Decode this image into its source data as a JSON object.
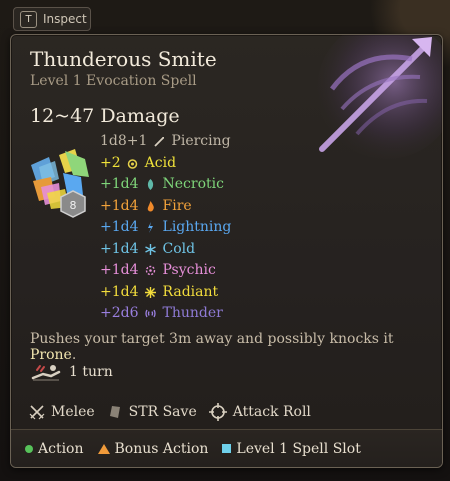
{
  "inspect": {
    "key": "T",
    "label": "Inspect"
  },
  "spell": {
    "title": "Thunderous Smite",
    "subtitle": "Level 1 Evocation Spell",
    "damage_total": "12~47 Damage",
    "dice_level": "8"
  },
  "damage": [
    {
      "amount": "1d8+1",
      "icon": "sword-icon",
      "type": "Piercing"
    },
    {
      "amount": "+2",
      "icon": "acid-icon",
      "type": "Acid"
    },
    {
      "amount": "+1d4",
      "icon": "necrotic-icon",
      "type": "Necrotic"
    },
    {
      "amount": "+1d4",
      "icon": "fire-icon",
      "type": "Fire"
    },
    {
      "amount": "+1d4",
      "icon": "lightning-icon",
      "type": "Lightning"
    },
    {
      "amount": "+1d4",
      "icon": "cold-icon",
      "type": "Cold"
    },
    {
      "amount": "+1d4",
      "icon": "psychic-icon",
      "type": "Psychic"
    },
    {
      "amount": "+1d4",
      "icon": "radiant-icon",
      "type": "Radiant"
    },
    {
      "amount": "+2d6",
      "icon": "thunder-icon",
      "type": "Thunder"
    }
  ],
  "description": {
    "text": "Pushes your target 3m away and possibly knocks it ",
    "keyword": "Prone",
    "end": "."
  },
  "duration": {
    "icon": "prone-icon",
    "label": "1 turn"
  },
  "properties": [
    {
      "icon": "melee-icon",
      "label": "Melee"
    },
    {
      "icon": "save-icon",
      "label": "STR Save"
    },
    {
      "icon": "crosshair-icon",
      "label": "Attack Roll"
    }
  ],
  "costs": [
    {
      "icon": "action-dot-icon",
      "label": "Action"
    },
    {
      "icon": "bonus-triangle-icon",
      "label": "Bonus Action"
    },
    {
      "icon": "spell-slot-icon",
      "label": "Level 1 Spell Slot"
    }
  ],
  "colors": {
    "acid": "#f0e23a",
    "necrotic": "#7fd67a",
    "fire": "#f2a23a",
    "lightning": "#5aa8f0",
    "cold": "#6fc4e6",
    "psychic": "#e68fd8",
    "radiant": "#f2dc3c",
    "thunder": "#9a7fe0"
  }
}
